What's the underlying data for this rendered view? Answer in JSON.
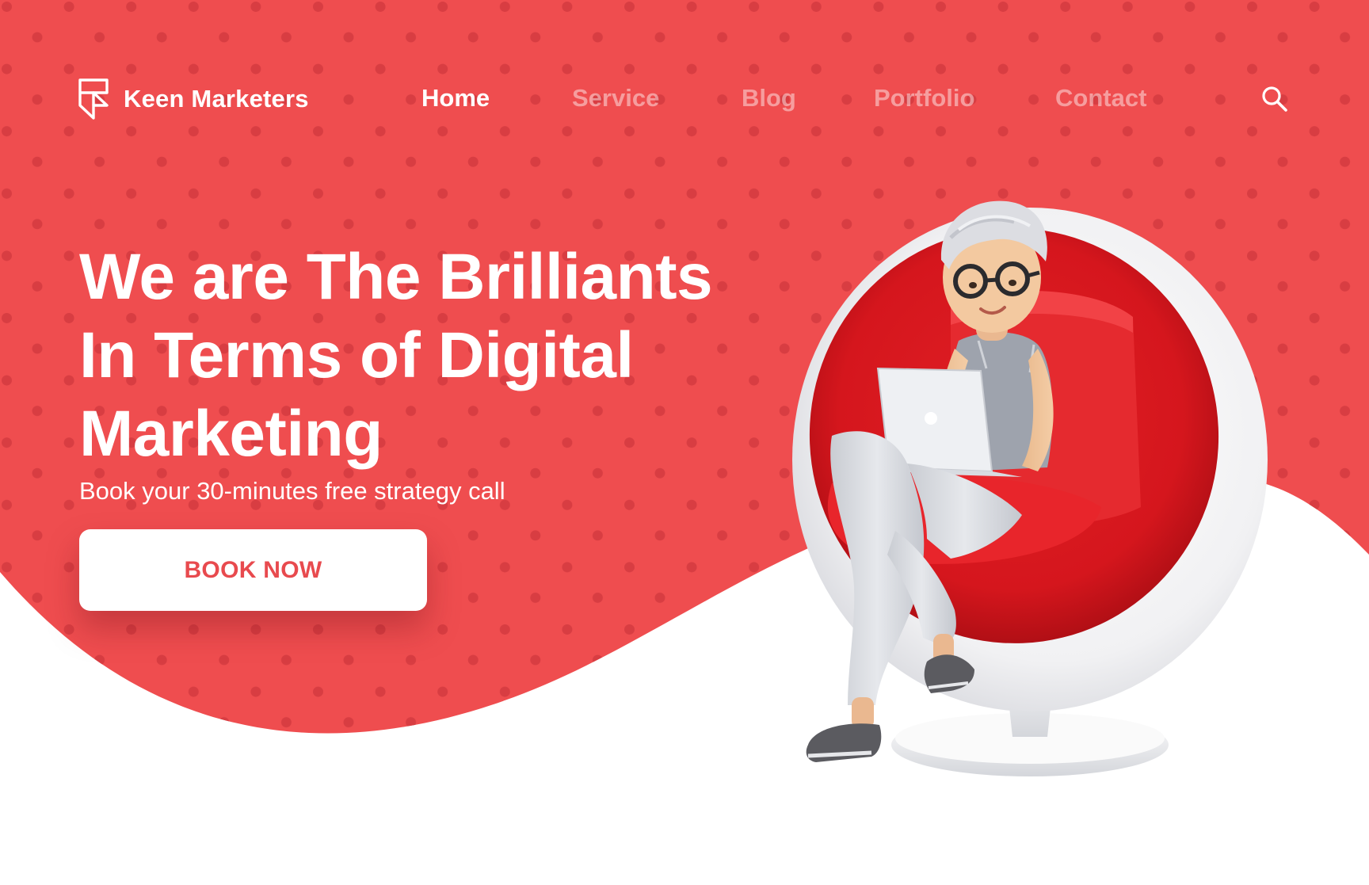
{
  "brand": {
    "name": "Keen Marketers",
    "logo_icon": "framer-logo-icon"
  },
  "nav": {
    "items": [
      {
        "label": "Home",
        "active": true
      },
      {
        "label": "Service",
        "active": false
      },
      {
        "label": "Blog",
        "active": false
      },
      {
        "label": "Portfolio",
        "active": false
      },
      {
        "label": "Contact",
        "active": false
      }
    ],
    "search_icon": "search-icon"
  },
  "hero": {
    "headline_lines": [
      "We are The Brilliants",
      "In Terms of Digital",
      "Marketing"
    ],
    "subline": "Book your 30-minutes free strategy call",
    "cta_label": "BOOK NOW"
  },
  "illustration": {
    "icon": "woman-in-egg-chair-with-laptop-illustration"
  },
  "colors": {
    "primary": "#EF4D4F",
    "dot": "#D83D42",
    "white": "#FFFFFF",
    "nav_inactive": "#F79A9B",
    "cta_text": "#E84A4E"
  }
}
